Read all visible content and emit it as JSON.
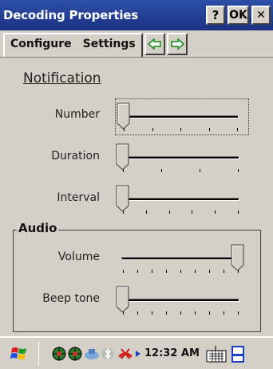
{
  "window": {
    "title": "Decoding Properties",
    "help_label": "?",
    "ok_label": "OK",
    "close_label": "✕"
  },
  "tabs": [
    {
      "label": "Configure"
    },
    {
      "label": "Settings"
    }
  ],
  "notification": {
    "heading": "Notification",
    "sliders": [
      {
        "label": "Number",
        "position": 0
      },
      {
        "label": "Duration",
        "position": 0
      },
      {
        "label": "Interval",
        "position": 0
      }
    ]
  },
  "audio": {
    "heading": "Audio",
    "sliders": [
      {
        "label": "Volume",
        "position": 1
      },
      {
        "label": "Beep tone",
        "position": 0
      }
    ]
  },
  "taskbar": {
    "clock": "12:32 AM"
  },
  "icons": {
    "start": "windows-flag-icon",
    "tray": [
      "network-globe-icon",
      "network-globe-icon",
      "bluetooth-manager-icon",
      "bluetooth-icon",
      "phone-stop-icon",
      "play-arrow-icon"
    ],
    "keyboard": "keyboard-icon",
    "desktop": "desktop-icon"
  },
  "colors": {
    "titlebar": "#1f3c8c",
    "face": "#d4d0c8",
    "arrow": "#1a8a1a"
  }
}
